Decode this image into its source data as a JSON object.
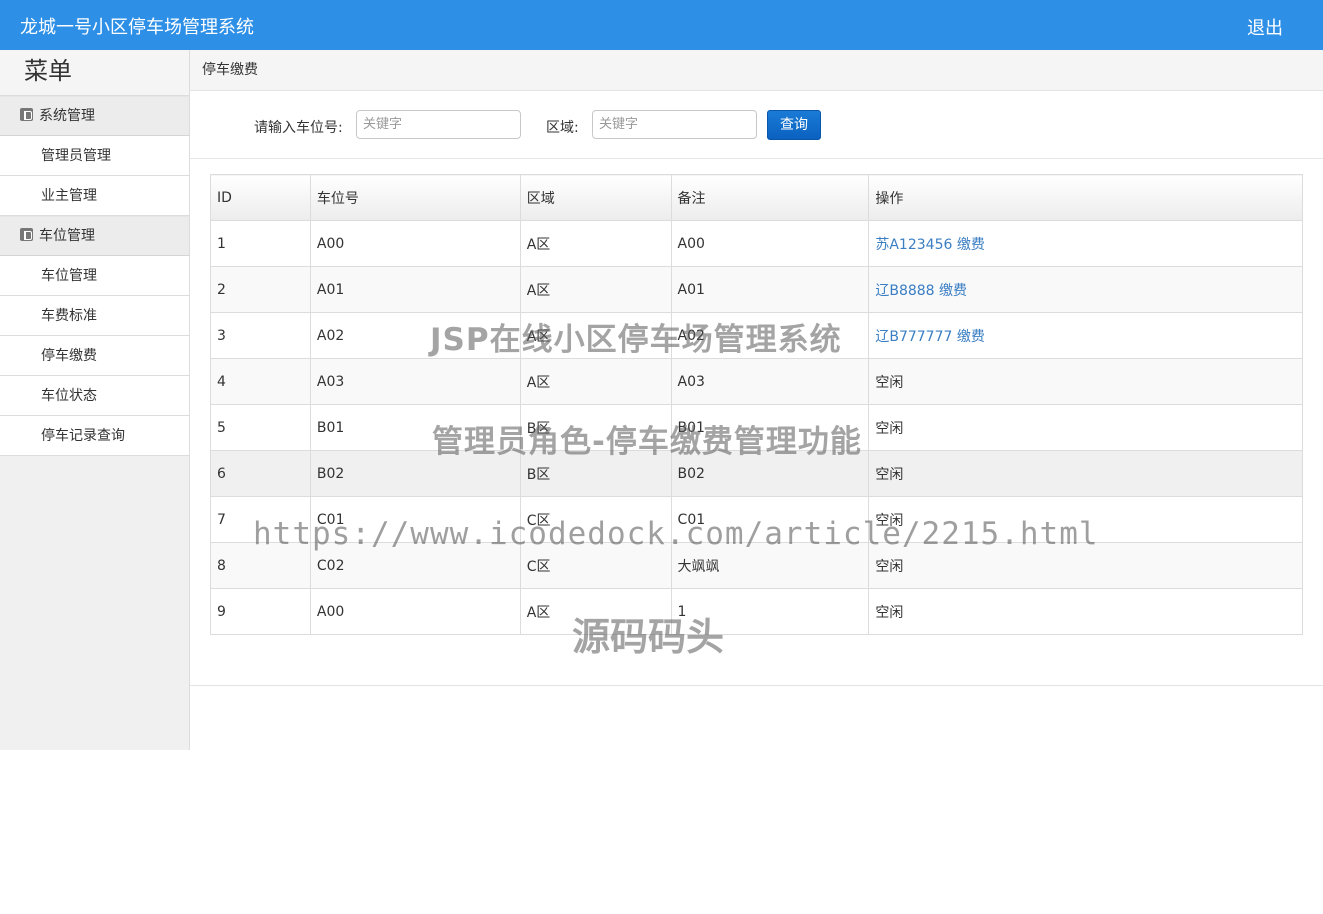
{
  "header": {
    "title": "龙城一号小区停车场管理系统",
    "logout_label": "退出",
    "bg_color": "#2d8fe6"
  },
  "sidebar": {
    "menu_title": "菜单",
    "groups": [
      {
        "label": "系统管理",
        "items": [
          "管理员管理",
          "业主管理"
        ]
      },
      {
        "label": "车位管理",
        "items": [
          "车位管理",
          "车费标准",
          "停车缴费",
          "车位状态",
          "停车记录查询"
        ]
      }
    ]
  },
  "breadcrumb": "停车缴费",
  "search": {
    "space_label": "请输入车位号:",
    "space_placeholder": "关键字",
    "area_label": "区域:",
    "area_placeholder": "关键字",
    "button_label": "查询"
  },
  "table": {
    "columns": [
      "ID",
      "车位号",
      "区域",
      "备注",
      "操作"
    ],
    "rows": [
      {
        "id": "1",
        "space": "A00",
        "area": "A区",
        "note": "A00",
        "op": "苏A123456 缴费",
        "op_link": true
      },
      {
        "id": "2",
        "space": "A01",
        "area": "A区",
        "note": "A01",
        "op": "辽B8888 缴费",
        "op_link": true
      },
      {
        "id": "3",
        "space": "A02",
        "area": "A区",
        "note": "A02",
        "op": "辽B777777 缴费",
        "op_link": true
      },
      {
        "id": "4",
        "space": "A03",
        "area": "A区",
        "note": "A03",
        "op": "空闲",
        "op_link": false
      },
      {
        "id": "5",
        "space": "B01",
        "area": "B区",
        "note": "B01",
        "op": "空闲",
        "op_link": false
      },
      {
        "id": "6",
        "space": "B02",
        "area": "B区",
        "note": "B02",
        "op": "空闲",
        "op_link": false
      },
      {
        "id": "7",
        "space": "C01",
        "area": "C区",
        "note": "C01",
        "op": "空闲",
        "op_link": false
      },
      {
        "id": "8",
        "space": "C02",
        "area": "C区",
        "note": "大飒飒",
        "op": "空闲",
        "op_link": false
      },
      {
        "id": "9",
        "space": "A00",
        "area": "A区",
        "note": "1",
        "op": "空闲",
        "op_link": false
      }
    ]
  },
  "watermark": {
    "line1": "JSP在线小区停车场管理系统",
    "line2": "管理员角色-停车缴费管理功能",
    "line3": "https://www.icodedock.com/article/2215.html",
    "line4": "源码码头"
  }
}
